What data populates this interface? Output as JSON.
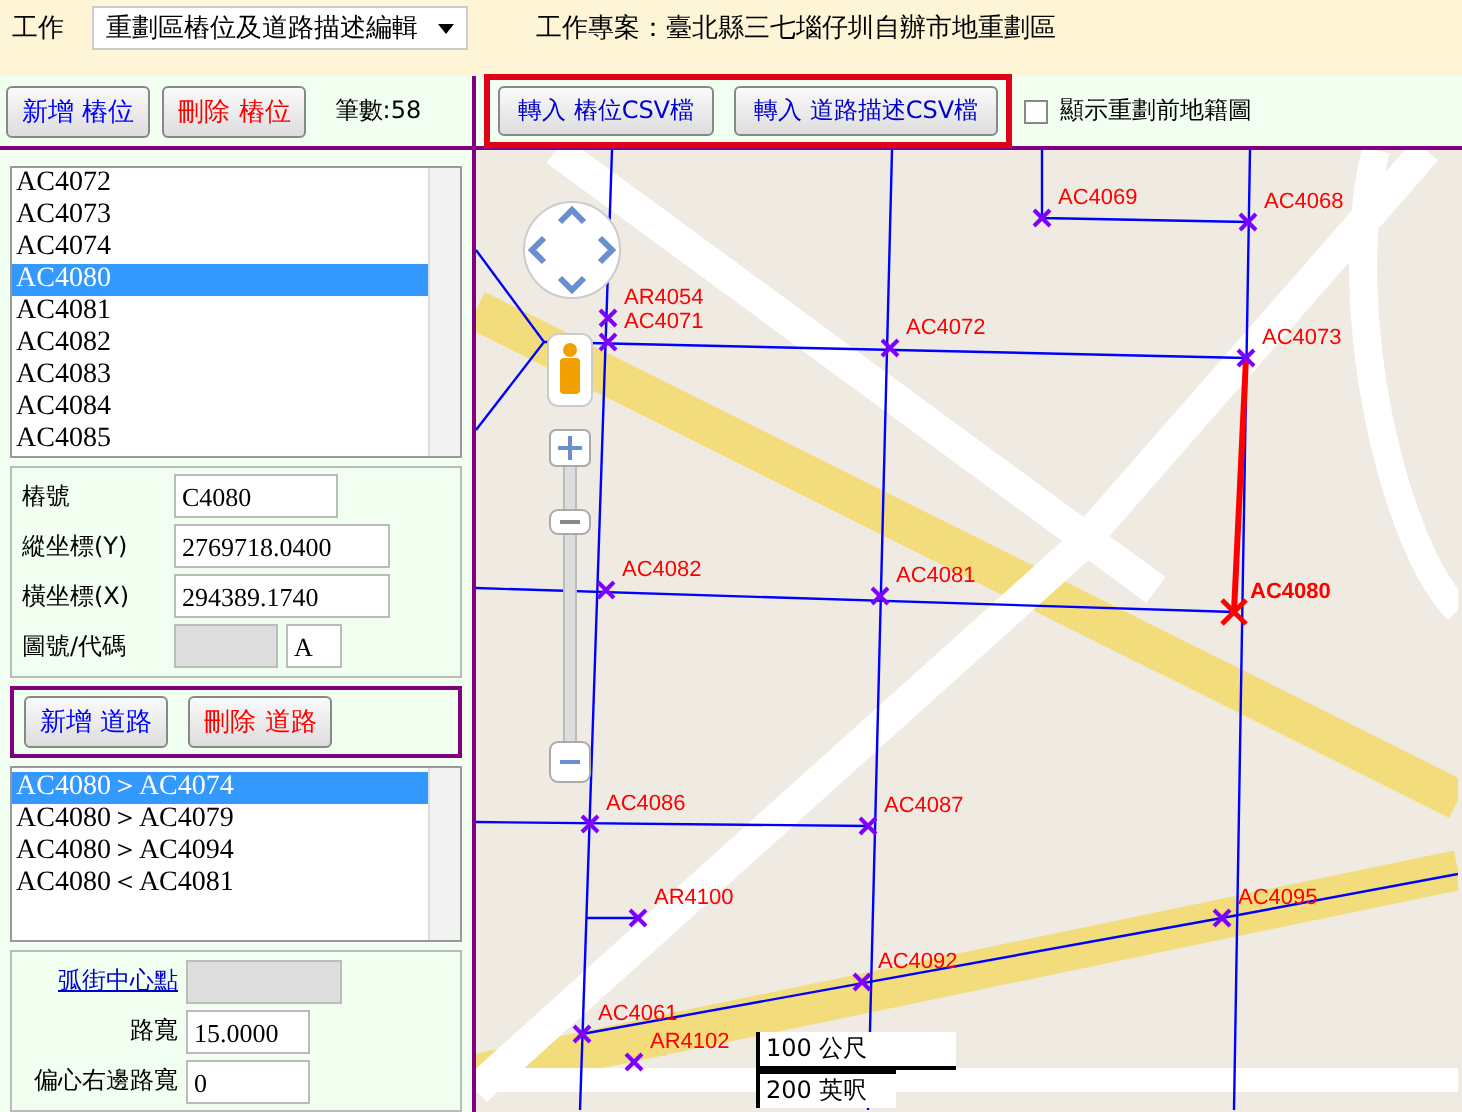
{
  "toolbar": {
    "label": "工作",
    "task": "重劃區樁位及道路描述編輯",
    "project": "工作專案：臺北縣三七堖仔圳自辦市地重劃區"
  },
  "stake_buttons": [
    {
      "kind": "add",
      "label": "新增 樁位"
    },
    {
      "kind": "delete",
      "label": "刪除 樁位"
    }
  ],
  "count": "筆數:58",
  "import_buttons": [
    "轉入 樁位CSV檔",
    "轉入 道路描述CSV檔"
  ],
  "show_cadastral": {
    "label": "顯示重劃前地籍圖",
    "checked": false
  },
  "stake_list": [
    {
      "label": "AC4072",
      "selected": false
    },
    {
      "label": "AC4073",
      "selected": false
    },
    {
      "label": "AC4074",
      "selected": false
    },
    {
      "label": "AC4080",
      "selected": true
    },
    {
      "label": "AC4081",
      "selected": false
    },
    {
      "label": "AC4082",
      "selected": false
    },
    {
      "label": "AC4083",
      "selected": false
    },
    {
      "label": "AC4084",
      "selected": false
    },
    {
      "label": "AC4085",
      "selected": false
    }
  ],
  "stake_form": [
    {
      "kind": "text",
      "label": "樁號",
      "value": "C4080"
    },
    {
      "kind": "wide",
      "label": "縱坐標(Y)",
      "value": "2769718.0400"
    },
    {
      "kind": "wide",
      "label": "橫坐標(X)",
      "value": "294389.1740"
    },
    {
      "kind": "code",
      "label": "圖號/代碼",
      "value": "A"
    }
  ],
  "road_buttons": [
    {
      "kind": "add",
      "label": "新增 道路"
    },
    {
      "kind": "delete",
      "label": "刪除 道路"
    }
  ],
  "road_list": [
    {
      "label": "AC4080＞AC4074",
      "selected": true
    },
    {
      "label": "AC4080＞AC4079",
      "selected": false
    },
    {
      "label": "AC4080＞AC4094",
      "selected": false
    },
    {
      "label": "AC4080＜AC4081",
      "selected": false
    }
  ],
  "road_form": {
    "center_link": "弧街中心點",
    "fields": [
      {
        "label": "路寬",
        "value": "15.0000"
      },
      {
        "label": "偏心右邊路寬",
        "value": "0"
      }
    ]
  },
  "map": {
    "stakes": [
      {
        "label": "AC4069",
        "selected": false
      },
      {
        "label": "AC4068",
        "selected": false
      },
      {
        "label": "AR4054",
        "selected": false
      },
      {
        "label": "AC4071",
        "selected": false
      },
      {
        "label": "AC4072",
        "selected": false
      },
      {
        "label": "AC4073",
        "selected": false
      },
      {
        "label": "AC4082",
        "selected": false
      },
      {
        "label": "AC4081",
        "selected": false
      },
      {
        "label": "AC4080",
        "selected": true
      },
      {
        "label": "AC4086",
        "selected": false
      },
      {
        "label": "AC4087",
        "selected": false
      },
      {
        "label": "AR4100",
        "selected": false
      },
      {
        "label": "AC4095",
        "selected": false
      },
      {
        "label": "AC4092",
        "selected": false
      },
      {
        "label": "AC4061",
        "selected": false
      },
      {
        "label": "AR4102",
        "selected": false
      }
    ],
    "scale": [
      "100 公尺",
      "200 英呎"
    ]
  }
}
